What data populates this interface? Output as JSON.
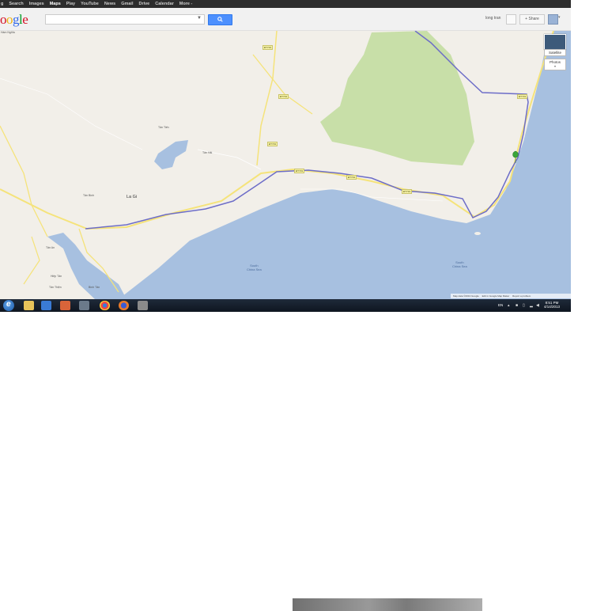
{
  "topnav": {
    "items": [
      "g",
      "Search",
      "Images",
      "Maps",
      "Play",
      "YouTube",
      "News",
      "Gmail",
      "Drive",
      "Calendar",
      "More -"
    ],
    "active": "Maps"
  },
  "logo": {
    "text_parts": [
      "o",
      "o",
      "g",
      "l",
      "e"
    ]
  },
  "search": {
    "value": "",
    "dropdown_icon": "chevron-down-icon",
    "button_icon": "search-icon"
  },
  "user": {
    "name": "long tran",
    "share_label": "+ Share"
  },
  "map_controls": {
    "satellite_label": "Satellite",
    "photos_label": "Photos"
  },
  "map_labels": {
    "top_left": "Hàm Nghĩa",
    "la_gi": "La Gi",
    "tan_tien": "Tân Tiến",
    "tan_binh": "Tân Bình",
    "tan_hai": "Tân Hải",
    "south_china_sea_1": "South\nChina Sea",
    "south_china_sea_2": "South\nChina Sea",
    "tan_an": "Tân An",
    "tan_thien": "Tân Thiện",
    "binh_tan": "Bình Tân",
    "hiep_tan": "Hiệp Tân"
  },
  "road_labels": [
    "ĐT719",
    "ĐT719",
    "ĐT719",
    "ĐT719",
    "ĐT719",
    "ĐT719",
    "ĐT719"
  ],
  "footer": {
    "map_data": "Map data ©2013 Google",
    "edit": "Edit in Google Map Maker",
    "report": "Report a problem"
  },
  "taskbar": {
    "lang": "EN",
    "time": "8:51 PM",
    "date": "4/14/2013",
    "apps": [
      "ie-icon",
      "explorer-icon",
      "media-player-icon",
      "paint-icon",
      "network-icon",
      "chrome-icon",
      "firefox-icon",
      "tool-icon"
    ]
  },
  "colors": {
    "water": "#a7c0e0",
    "land": "#f2efe9",
    "park": "#c8dfa8",
    "route": "#6d6dc8",
    "road": "#f5e37a",
    "search_button": "#4d90fe"
  }
}
